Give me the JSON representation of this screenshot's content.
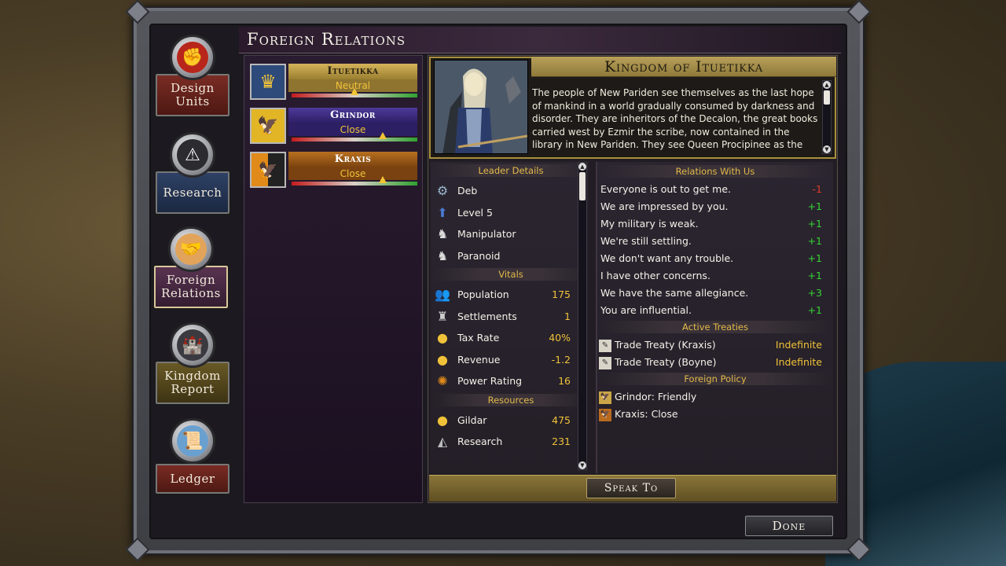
{
  "title": "Foreign Relations",
  "nav": [
    {
      "label_1": "Design",
      "label_2": "Units",
      "icon": "fist-icon"
    },
    {
      "label_1": "Research",
      "label_2": "",
      "icon": "compass-icon"
    },
    {
      "label_1": "Foreign",
      "label_2": "Relations",
      "icon": "handshake-icon"
    },
    {
      "label_1": "Kingdom",
      "label_2": "Report",
      "icon": "castle-icon"
    },
    {
      "label_1": "Ledger",
      "label_2": "",
      "icon": "scroll-icon"
    }
  ],
  "kingdoms": [
    {
      "name": "Ituetikka",
      "status": "Neutral",
      "relation_level": 0.5,
      "color": "#c9a548",
      "emblem": "crown-icon"
    },
    {
      "name": "Grindor",
      "status": "Close",
      "relation_level": 0.72,
      "color": "#3b2a7e",
      "emblem": "bird-icon"
    },
    {
      "name": "Kraxis",
      "status": "Close",
      "relation_level": 0.72,
      "color": "#b86a1f",
      "emblem": "bird-icon"
    }
  ],
  "detail": {
    "title": "Kingdom of Ituetikka",
    "description": "The people of New Pariden see themselves as the last hope of mankind in a world gradually consumed by darkness and disorder. They are inheritors of the Decalon, the great books carried west by Ezmir the scribe, now contained in the library in New Pariden. They see Queen Procipinee as the heir to the"
  },
  "leader_details": {
    "header": "Leader Details",
    "items": [
      {
        "label": "Deb",
        "icon": "leader-icon"
      },
      {
        "label": "Level 5",
        "icon": "level-icon"
      },
      {
        "label": "Manipulator",
        "icon": "trait-icon"
      },
      {
        "label": "Paranoid",
        "icon": "trait-icon"
      }
    ]
  },
  "vitals": {
    "header": "Vitals",
    "items": [
      {
        "label": "Population",
        "value": "175",
        "icon": "population-icon"
      },
      {
        "label": "Settlements",
        "value": "1",
        "icon": "tower-icon"
      },
      {
        "label": "Tax Rate",
        "value": "40%",
        "icon": "coins-icon"
      },
      {
        "label": "Revenue",
        "value": "-1.2",
        "icon": "coins-icon"
      },
      {
        "label": "Power Rating",
        "value": "16",
        "icon": "sun-icon"
      }
    ]
  },
  "resources": {
    "header": "Resources",
    "items": [
      {
        "label": "Gildar",
        "value": "475",
        "icon": "coins-icon"
      },
      {
        "label": "Research",
        "value": "231",
        "icon": "research-icon"
      }
    ]
  },
  "relations": {
    "header": "Relations With Us",
    "items": [
      {
        "label": "Everyone is out to get me.",
        "value": "-1"
      },
      {
        "label": "We are impressed by you.",
        "value": "+1"
      },
      {
        "label": "My military is weak.",
        "value": "+1"
      },
      {
        "label": "We're still settling.",
        "value": "+1"
      },
      {
        "label": "We don't want any trouble.",
        "value": "+1"
      },
      {
        "label": "I have other concerns.",
        "value": "+1"
      },
      {
        "label": "We have the same allegiance.",
        "value": "+3"
      },
      {
        "label": "You are influential.",
        "value": "+1"
      }
    ]
  },
  "treaties": {
    "header": "Active Treaties",
    "items": [
      {
        "label": "Trade Treaty (Kraxis)",
        "value": "Indefinite"
      },
      {
        "label": "Trade Treaty (Boyne)",
        "value": "Indefinite"
      }
    ]
  },
  "policy": {
    "header": "Foreign Policy",
    "items": [
      {
        "label": "Grindor: Friendly",
        "color": "#c9a548"
      },
      {
        "label": "Kraxis: Close",
        "color": "#b86a1f"
      }
    ]
  },
  "buttons": {
    "speak": "Speak To",
    "done": "Done"
  }
}
